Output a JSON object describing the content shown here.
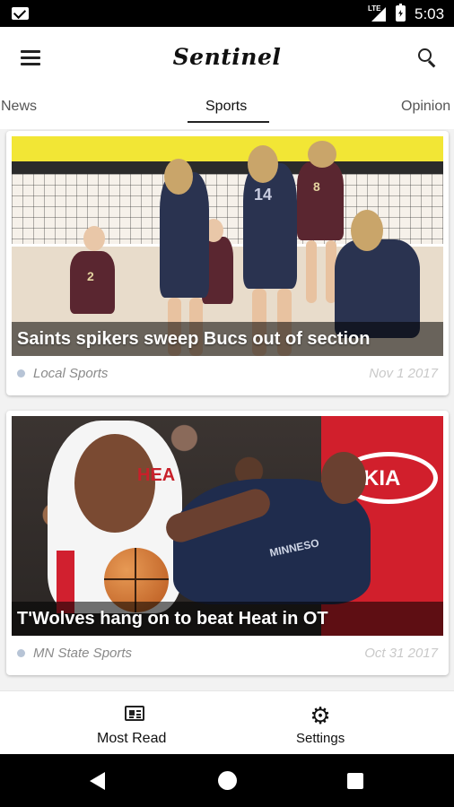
{
  "status_bar": {
    "time": "5:03",
    "network": "LTE",
    "icons": [
      "gmail-icon",
      "signal-icon",
      "battery-charging-icon"
    ]
  },
  "app_bar": {
    "title": "Sentinel",
    "icons": [
      "menu-icon",
      "search-icon"
    ]
  },
  "tabs": [
    {
      "label": "News",
      "active": false
    },
    {
      "label": "Sports",
      "active": true
    },
    {
      "label": "Opinion",
      "active": false
    }
  ],
  "articles": [
    {
      "headline": "Saints spikers sweep Bucs out of section",
      "category": "Local Sports",
      "date": "Nov 1 2017"
    },
    {
      "headline": "T'Wolves hang on to beat Heat in OT",
      "category": "MN State Sports",
      "date": "Oct 31 2017"
    }
  ],
  "photo_text": {
    "jersey_numbers": [
      "14",
      "8",
      "2"
    ],
    "sponsor": "KIA",
    "heat_jersey": "HEA",
    "wolves_jersey": "MINNESO"
  },
  "bottom_nav": [
    {
      "label": "Most Read",
      "icon": "newspaper-icon"
    },
    {
      "label": "Settings",
      "icon": "gear-icon"
    }
  ],
  "colors": {
    "accent": "#222222",
    "category_dot": "#b7c4d6",
    "date_text": "#c9c9c9"
  }
}
